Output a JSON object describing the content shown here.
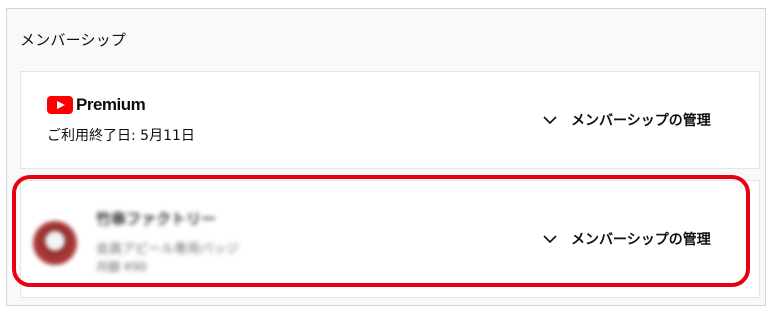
{
  "section": {
    "title": "メンバーシップ"
  },
  "premium": {
    "logo_text": "Premium",
    "renewal": "ご利用終了日: 5月11日",
    "manage_label": "メンバーシップの管理"
  },
  "channel": {
    "name": "竹串ファクトリー",
    "badge_text": "会員アピール専用バッジ",
    "price_text": "月額 ¥90",
    "manage_label": "メンバーシップの管理"
  },
  "colors": {
    "highlight": "#e60012",
    "youtube_red": "#ff0000"
  },
  "icons": [
    "youtube-logo-icon",
    "chevron-down-icon"
  ]
}
